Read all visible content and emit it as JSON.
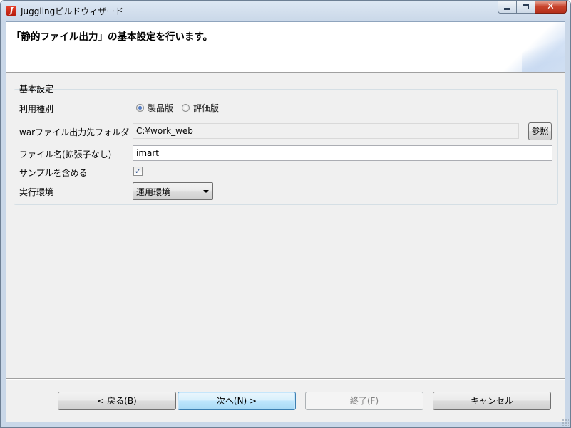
{
  "window": {
    "title": "Jugglingビルドウィザード",
    "icon": "juggling-app-icon",
    "controls": {
      "minimize": "minimize-icon",
      "maximize": "maximize-icon",
      "close": "close-icon",
      "close_glyph": "✕"
    }
  },
  "header": {
    "title": "「静的ファイル出力」の基本設定を行います。"
  },
  "basic_settings": {
    "legend": "基本設定",
    "usage_type": {
      "label": "利用種別",
      "options": [
        {
          "label": "製品版",
          "checked": true
        },
        {
          "label": "評価版",
          "checked": false
        }
      ]
    },
    "war_output_folder": {
      "label": "warファイル出力先フォルダ",
      "value": "C:¥work_web",
      "browse_label": "参照"
    },
    "file_name": {
      "label": "ファイル名(拡張子なし)",
      "value": "imart"
    },
    "include_samples": {
      "label": "サンプルを含める",
      "checked": true,
      "check_glyph": "✓"
    },
    "runtime_env": {
      "label": "実行環境",
      "selected": "運用環境"
    }
  },
  "footer": {
    "back_label": "< 戻る(B)",
    "next_label": "次へ(N) >",
    "finish_label": "終了(F)",
    "cancel_label": "キャンセル"
  }
}
